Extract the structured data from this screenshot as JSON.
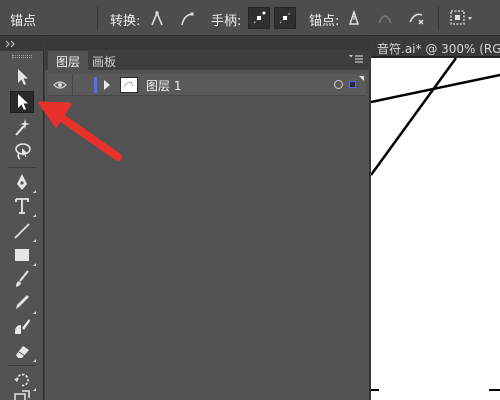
{
  "control_bar": {
    "anchor_label": "锚点",
    "convert_label": "转换:",
    "handle_label": "手柄:",
    "anchor_points_label": "锚点:"
  },
  "layers_panel": {
    "tabs": [
      {
        "label": "图层",
        "active": true
      },
      {
        "label": "画板",
        "active": false
      }
    ],
    "layer": {
      "name": "图层 1",
      "color": "#4f6cff"
    }
  },
  "document": {
    "tab_title": "音符.ai* @ 300% (RG"
  },
  "annotation": {
    "color": "#e8312a",
    "points_to": "direct-selection-tool"
  },
  "icons": [
    "selection-tool",
    "direct-selection-tool",
    "magic-wand-tool",
    "lasso-tool",
    "pen-tool",
    "type-tool",
    "line-tool",
    "rectangle-tool",
    "paintbrush-tool",
    "pencil-tool",
    "blob-brush-tool",
    "eraser-tool",
    "rotate-tool",
    "scale-tool"
  ]
}
